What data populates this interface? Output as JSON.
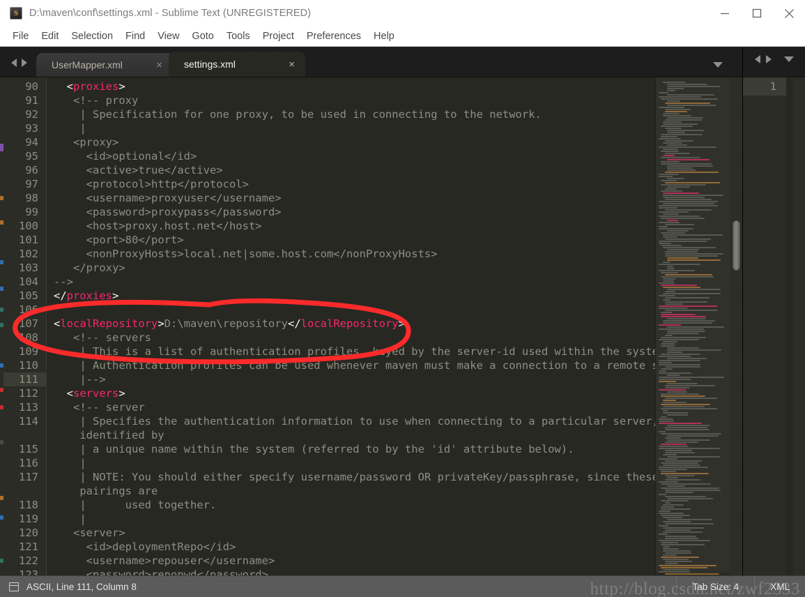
{
  "window": {
    "title": "D:\\maven\\conf\\settings.xml - Sublime Text (UNREGISTERED)",
    "icon": "sublime-text-icon",
    "controls": {
      "minimize": "minimize-icon",
      "maximize": "maximize-icon",
      "close": "close-icon"
    }
  },
  "menubar": {
    "items": [
      {
        "label": "File"
      },
      {
        "label": "Edit"
      },
      {
        "label": "Selection"
      },
      {
        "label": "Find"
      },
      {
        "label": "View"
      },
      {
        "label": "Goto"
      },
      {
        "label": "Tools"
      },
      {
        "label": "Project"
      },
      {
        "label": "Preferences"
      },
      {
        "label": "Help"
      }
    ]
  },
  "tabstrip": {
    "prev_icon": "arrow-left-icon",
    "next_icon": "arrow-right-icon",
    "dropdown_icon": "chevron-down-icon",
    "close_glyph": "×",
    "tabs": [
      {
        "label": "UserMapper.xml",
        "active": false
      },
      {
        "label": "settings.xml",
        "active": true
      }
    ]
  },
  "editor": {
    "active_line": 111,
    "first_visible_line": 90,
    "second_pane_line": "1",
    "lines": [
      {
        "num": "90",
        "indent": "  ",
        "spans": [
          {
            "t": "tg",
            "s": "<"
          },
          {
            "t": "tgn",
            "s": "proxies"
          },
          {
            "t": "tg",
            "s": ">"
          }
        ]
      },
      {
        "num": "91",
        "indent": "   ",
        "spans": [
          {
            "t": "cm",
            "s": "<!-- proxy"
          }
        ]
      },
      {
        "num": "92",
        "indent": "    ",
        "spans": [
          {
            "t": "cm",
            "s": "| Specification for one proxy, to be used in connecting to the network."
          }
        ]
      },
      {
        "num": "93",
        "indent": "    ",
        "spans": [
          {
            "t": "cm",
            "s": "|"
          }
        ]
      },
      {
        "num": "94",
        "indent": "   ",
        "spans": [
          {
            "t": "cm",
            "s": "<proxy>"
          }
        ]
      },
      {
        "num": "95",
        "indent": "     ",
        "spans": [
          {
            "t": "cm",
            "s": "<id>optional</id>"
          }
        ]
      },
      {
        "num": "96",
        "indent": "     ",
        "spans": [
          {
            "t": "cm",
            "s": "<active>true</active>"
          }
        ]
      },
      {
        "num": "97",
        "indent": "     ",
        "spans": [
          {
            "t": "cm",
            "s": "<protocol>http</protocol>"
          }
        ]
      },
      {
        "num": "98",
        "indent": "     ",
        "spans": [
          {
            "t": "cm",
            "s": "<username>proxyuser</username>"
          }
        ]
      },
      {
        "num": "99",
        "indent": "     ",
        "spans": [
          {
            "t": "cm",
            "s": "<password>proxypass</password>"
          }
        ]
      },
      {
        "num": "100",
        "indent": "     ",
        "spans": [
          {
            "t": "cm",
            "s": "<host>proxy.host.net</host>"
          }
        ]
      },
      {
        "num": "101",
        "indent": "     ",
        "spans": [
          {
            "t": "cm",
            "s": "<port>80</port>"
          }
        ]
      },
      {
        "num": "102",
        "indent": "     ",
        "spans": [
          {
            "t": "cm",
            "s": "<nonProxyHosts>local.net|some.host.com</nonProxyHosts>"
          }
        ]
      },
      {
        "num": "103",
        "indent": "   ",
        "spans": [
          {
            "t": "cm",
            "s": "</proxy>"
          }
        ]
      },
      {
        "num": "104",
        "indent": "",
        "spans": [
          {
            "t": "cm",
            "s": "-->"
          }
        ]
      },
      {
        "num": "105",
        "indent": "",
        "spans": [
          {
            "t": "tg",
            "s": "</"
          },
          {
            "t": "tgn",
            "s": "proxies"
          },
          {
            "t": "tg",
            "s": ">"
          }
        ]
      },
      {
        "num": "106",
        "indent": "",
        "spans": [
          {
            "t": "cm",
            "s": ""
          }
        ]
      },
      {
        "num": "107",
        "indent": "",
        "spans": [
          {
            "t": "tg",
            "s": "<"
          },
          {
            "t": "tgn",
            "s": "localRepository"
          },
          {
            "t": "tg",
            "s": ">"
          },
          {
            "t": "txt",
            "s": "D:\\maven\\repository"
          },
          {
            "t": "tg",
            "s": "</"
          },
          {
            "t": "tgn",
            "s": "localRepository"
          },
          {
            "t": "tg",
            "s": ">"
          }
        ]
      },
      {
        "num": "108",
        "indent": "   ",
        "spans": [
          {
            "t": "cm",
            "s": "<!-- servers"
          }
        ]
      },
      {
        "num": "109",
        "indent": "    ",
        "spans": [
          {
            "t": "cm",
            "s": "| This is a list of authentication profiles, keyed by the server-id used within the system."
          }
        ]
      },
      {
        "num": "110",
        "indent": "    ",
        "spans": [
          {
            "t": "cm",
            "s": "| Authentication profiles can be used whenever maven must make a connection to a remote server."
          }
        ]
      },
      {
        "num": "111",
        "indent": "    ",
        "spans": [
          {
            "t": "cm",
            "s": "|-->"
          }
        ]
      },
      {
        "num": "112",
        "indent": "  ",
        "spans": [
          {
            "t": "tg",
            "s": "<"
          },
          {
            "t": "tgn",
            "s": "servers"
          },
          {
            "t": "tg",
            "s": ">"
          }
        ]
      },
      {
        "num": "113",
        "indent": "   ",
        "spans": [
          {
            "t": "cm",
            "s": "<!-- server"
          }
        ]
      },
      {
        "num": "114",
        "indent": "    ",
        "spans": [
          {
            "t": "cm",
            "s": "| Specifies the authentication information to use when connecting to a particular server,"
          }
        ]
      },
      {
        "num": "",
        "indent": "    ",
        "wrapped": true,
        "spans": [
          {
            "t": "cm",
            "s": "identified by"
          }
        ]
      },
      {
        "num": "115",
        "indent": "    ",
        "spans": [
          {
            "t": "cm",
            "s": "| a unique name within the system (referred to by the 'id' attribute below)."
          }
        ]
      },
      {
        "num": "116",
        "indent": "    ",
        "spans": [
          {
            "t": "cm",
            "s": "|"
          }
        ]
      },
      {
        "num": "117",
        "indent": "    ",
        "spans": [
          {
            "t": "cm",
            "s": "| NOTE: You should either specify username/password OR privateKey/passphrase, since these"
          }
        ]
      },
      {
        "num": "",
        "indent": "    ",
        "wrapped": true,
        "spans": [
          {
            "t": "cm",
            "s": "pairings are"
          }
        ]
      },
      {
        "num": "118",
        "indent": "    ",
        "spans": [
          {
            "t": "cm",
            "s": "|      used together."
          }
        ]
      },
      {
        "num": "119",
        "indent": "    ",
        "spans": [
          {
            "t": "cm",
            "s": "|"
          }
        ]
      },
      {
        "num": "120",
        "indent": "   ",
        "spans": [
          {
            "t": "cm",
            "s": "<server>"
          }
        ]
      },
      {
        "num": "121",
        "indent": "     ",
        "spans": [
          {
            "t": "cm",
            "s": "<id>deploymentRepo</id>"
          }
        ]
      },
      {
        "num": "122",
        "indent": "     ",
        "spans": [
          {
            "t": "cm",
            "s": "<username>repouser</username>"
          }
        ]
      },
      {
        "num": "123",
        "indent": "     ",
        "spans": [
          {
            "t": "cm",
            "s": "<password>repopwd</password>"
          }
        ]
      }
    ]
  },
  "statusbar": {
    "encoding_icon": "file-encoding-icon",
    "position_text": "ASCII, Line 111, Column 8",
    "tab_size_text": "Tab Size: 4",
    "syntax_text": "XML"
  },
  "watermark": {
    "text": "http://blog.csdn.net/zwf2333"
  },
  "annotation": {
    "shape": "red-ellipse",
    "color": "#fc2b2b"
  },
  "colors": {
    "editor_bg": "#272822",
    "gutter_bg": "#2b2c26",
    "tag_name": "#f92672",
    "comment": "#8d8f82",
    "foreground": "#f8f8f2",
    "statusbar_bg": "#5a5a5a",
    "titlebar_bg": "#ffffff"
  }
}
